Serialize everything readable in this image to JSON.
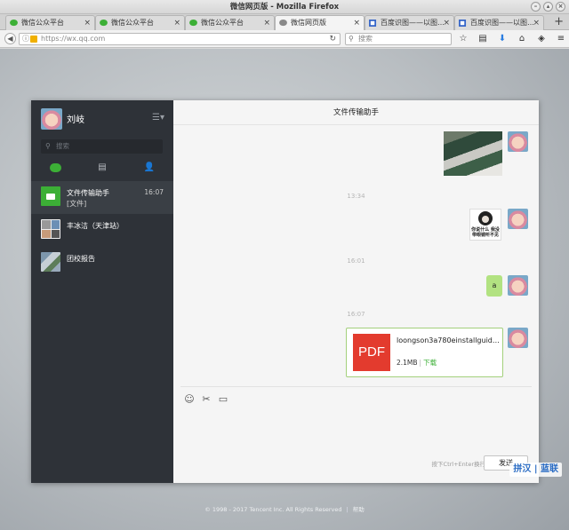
{
  "window": {
    "title": "微信网页版 - Mozilla Firefox"
  },
  "tabs": [
    {
      "label": "微信公众平台",
      "icon": "wechat-icon",
      "active": false
    },
    {
      "label": "微信公众平台",
      "icon": "wechat-icon",
      "active": false
    },
    {
      "label": "微信公众平台",
      "icon": "wechat-icon",
      "active": false
    },
    {
      "label": "微信网页版",
      "icon": "wechat-icon",
      "active": true
    },
    {
      "label": "百度识图——以图…",
      "icon": "baidu-icon",
      "active": false
    },
    {
      "label": "百度识图——以图…",
      "icon": "baidu-icon",
      "active": false
    }
  ],
  "navbar": {
    "url": "https://wx.qq.com",
    "search_placeholder": "搜索"
  },
  "sidebar": {
    "user_name": "刘岐",
    "search_placeholder": "搜索",
    "chats": [
      {
        "name": "文件传输助手",
        "time": "16:07",
        "preview": "[文件]",
        "active": true
      },
      {
        "name": "丰冰洁（天津站）",
        "time": "",
        "preview": "",
        "active": false
      },
      {
        "name": "团校报告",
        "time": "",
        "preview": "",
        "active": false
      }
    ]
  },
  "conversation": {
    "title": "文件传输助手",
    "timestamps": [
      "13:34",
      "16:01",
      "16:07"
    ],
    "meme_caption": "你说什么 我没 带眼镜听不见",
    "text_message": "a",
    "file": {
      "name": "loongson3a780einstallguidev…",
      "size": "2.1MB",
      "separator": "|",
      "download_label": "下载",
      "icon_label": "PDF"
    }
  },
  "composer": {
    "hint": "按下Ctrl+Enter换行",
    "send_label": "发送"
  },
  "footer": {
    "copyright": "© 1998 - 2017 Tencent Inc. All Rights Reserved",
    "help": "帮助"
  },
  "watermark": "拼汉 | 蓝联",
  "colors": {
    "wechat_green": "#3caf36",
    "bubble_green": "#b2e281",
    "sidebar_bg": "#2e3238",
    "pdf_red": "#e33b2e"
  }
}
